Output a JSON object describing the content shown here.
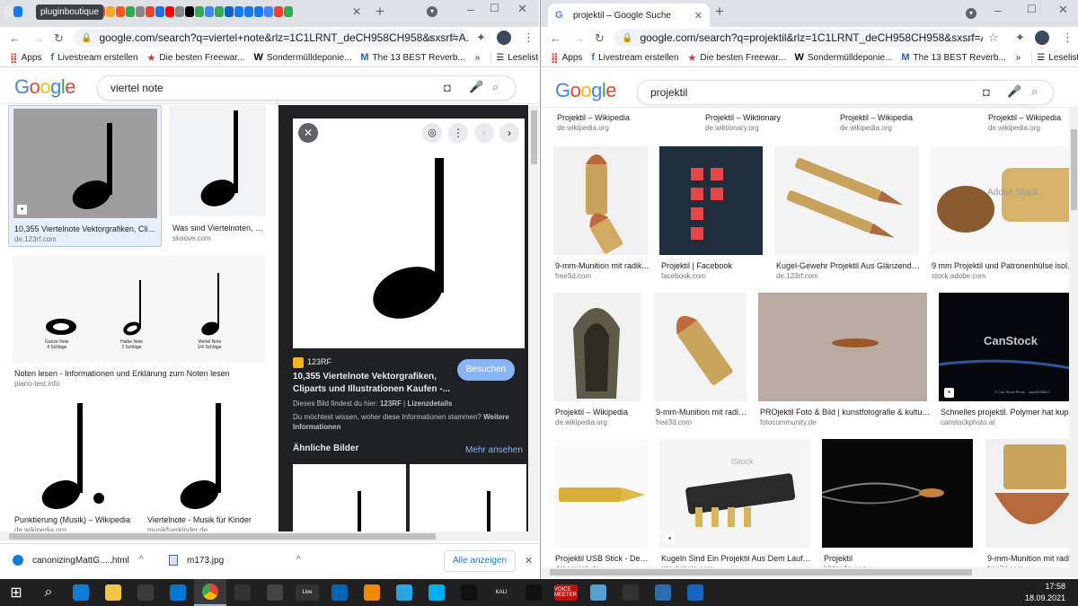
{
  "left_window": {
    "tab_tooltip": "pluginboutique",
    "new_tab": "+",
    "url": "google.com/search?q=viertel+note&rlz=1C1LRNT_deCH958CH958&sxsrf=A...",
    "bookmarks": [
      {
        "label": "Apps",
        "icon": "apps-grid-icon"
      },
      {
        "label": "Livestream erstellen",
        "icon": "facebook-icon"
      },
      {
        "label": "Die besten Freewar...",
        "icon": "star-icon"
      },
      {
        "label": "Sondermülldeponie...",
        "icon": "wikipedia-icon"
      },
      {
        "label": "The 13 BEST Reverb...",
        "icon": "m-logo-icon"
      }
    ],
    "bookmark_more": "»",
    "reading_list": "Leseliste",
    "search_query": "viertel note",
    "results": [
      {
        "title": "10,355 Viertelnote Vektorgrafiken, Clipar...",
        "source": "de.123rf.com"
      },
      {
        "title": "Was sind Viertelnoten, hal...",
        "source": "skoove.com"
      },
      {
        "title": "Noten lesen - Informationen und Erklärung zum Noten lesen",
        "source": "piano-test.info"
      },
      {
        "title": "Punktierung (Musik) – Wikipedia",
        "source": "de.wikipedia.org"
      },
      {
        "title": "Viertelnote - Musik für Kinder",
        "source": "musikfuerkinder.de"
      }
    ],
    "notes_labels": [
      {
        "name": "Ganze Note",
        "beats": "4 Schläge"
      },
      {
        "name": "Halbe Note",
        "beats": "2 Schläge"
      },
      {
        "name": "Viertel Note",
        "beats": "1/4 Schläge"
      }
    ],
    "preview": {
      "site": "123RF",
      "title": "10,355 Viertelnote Vektorgrafiken, Cliparts und Illustrationen Kaufen -...",
      "visit_button": "Besuchen",
      "license_prefix": "Dieses Bild findest du hier: ",
      "license_site": "123RF",
      "license_sep": " | ",
      "license_link": "Lizenzdetails",
      "info_question": "Du möchtest wissen, woher diese Informationen stammen? ",
      "info_link": "Weitere Informationen",
      "similar_heading": "Ähnliche Bilder",
      "more_link": "Mehr ansehen"
    },
    "downloads": [
      {
        "name": "canonizingMattG.....html",
        "icon": "edge-file-icon"
      },
      {
        "name": "m173.jpg",
        "icon": "image-file-icon"
      }
    ],
    "show_all": "Alle anzeigen"
  },
  "right_window": {
    "tab_title": "projektil – Google Suche",
    "new_tab": "+",
    "url": "google.com/search?q=projektil&rlz=1C1LRNT_deCH958CH958&sxsrf=AOa...",
    "bookmarks": [
      {
        "label": "Apps",
        "icon": "apps-grid-icon"
      },
      {
        "label": "Livestream erstellen",
        "icon": "facebook-icon"
      },
      {
        "label": "Die besten Freewar...",
        "icon": "star-icon"
      },
      {
        "label": "Sondermülldeponie...",
        "icon": "wikipedia-icon"
      },
      {
        "label": "The 13 BEST Reverb...",
        "icon": "m-logo-icon"
      }
    ],
    "bookmark_more": "»",
    "reading_list": "Leseliste",
    "search_query": "projektil",
    "top_row": [
      {
        "title": "Projektil – Wikipedia",
        "source": "de.wikipedia.org"
      },
      {
        "title": "Projektil – Wiktionary",
        "source": "de.wiktionary.org"
      },
      {
        "title": "Projektil – Wikipedia",
        "source": "de.wikipedia.org"
      },
      {
        "title": "Projektil – Wikipedia",
        "source": "de.wikipedia.org"
      }
    ],
    "row1": [
      {
        "title": "9-mm-Munition mit radik...",
        "source": "free3d.com"
      },
      {
        "title": "Projektil | Facebook",
        "source": "facebook.com"
      },
      {
        "title": "Kugel-Gewehr Projektil Aus Glänzendem...",
        "source": "de.123rf.com"
      },
      {
        "title": "9 mm Projektil und Patronenhülse isoliert...",
        "source": "stock.adobe.com"
      }
    ],
    "row2": [
      {
        "title": "Projektil – Wikipedia",
        "source": "de.wikipedia.org"
      },
      {
        "title": "9-mm-Munition mit radik...",
        "source": "free3d.com"
      },
      {
        "title": "PROjektil Foto & Bild | kunstfotografie & kultur, ...",
        "source": "fotocommunity.de"
      },
      {
        "title": "Schnelles projektil. Polymer hat kupfern...",
        "source": "canstockphoto.at"
      }
    ],
    "row3": [
      {
        "title": "Projektil USB Stick - Deko...",
        "source": "dekomisch.de"
      },
      {
        "title": "Kugeln Sind Ein Projektil Aus Dem Lauf Ei...",
        "source": "istockphoto.com"
      },
      {
        "title": "Projektil",
        "source": "bilder.4ever.eu"
      },
      {
        "title": "9-mm-Munition mit radik...",
        "source": "free3d.com"
      }
    ],
    "watermarks": {
      "adobe": "Adobe Stock",
      "canstock": "CanStock",
      "istock": "iStock",
      "canstock_small": "© Can Stock Photo - csp44036817"
    }
  },
  "taskbar": {
    "apps": [
      "windows-start-icon",
      "search-icon",
      "edge-icon",
      "file-explorer-icon",
      "store-icon",
      "mail-icon",
      "chrome-icon",
      "gamepad-icon",
      "inkscape-icon",
      "live-icon",
      "outlook-icon",
      "vlc-icon",
      "telegram-icon",
      "skype-icon",
      "game-bar-icon",
      "kali-icon",
      "capcut-icon",
      "voicemeeter-icon",
      "chat-icon",
      "photos-icon",
      "cube-icon",
      "screen-icon"
    ],
    "live_label": "Live",
    "kali_label": "KALI",
    "voicemeeter_label": "VOICE MEETER",
    "time": "17:58",
    "date": "18.09.2021"
  },
  "colors": {
    "google_blue": "#4285f4",
    "google_red": "#ea4335",
    "google_yellow": "#fbbc05",
    "google_green": "#34a853",
    "link_blue": "#8ab4f8",
    "visit_button": "#8ab4f8"
  }
}
